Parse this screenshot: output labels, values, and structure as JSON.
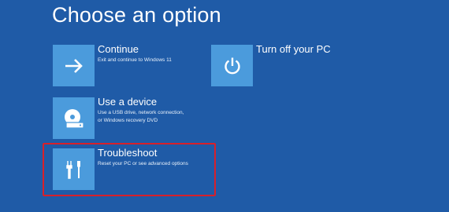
{
  "title": "Choose an option",
  "options": [
    {
      "key": "continue",
      "label": "Continue",
      "description": [
        "Exit and continue to Windows 11"
      ],
      "icon": "arrow-right-icon"
    },
    {
      "key": "use-device",
      "label": "Use a device",
      "description": [
        "Use a USB drive, network connection,",
        "or Windows recovery DVD"
      ],
      "icon": "disc-drive-icon"
    },
    {
      "key": "troubleshoot",
      "label": "Troubleshoot",
      "description": [
        "Reset your PC or see advanced options"
      ],
      "icon": "tools-icon"
    },
    {
      "key": "turn-off",
      "label": "Turn off your PC",
      "description": [],
      "icon": "power-icon"
    }
  ],
  "colors": {
    "background": "#1f5ba7",
    "tile": "#4b9bdc",
    "highlight": "#d8202a"
  }
}
